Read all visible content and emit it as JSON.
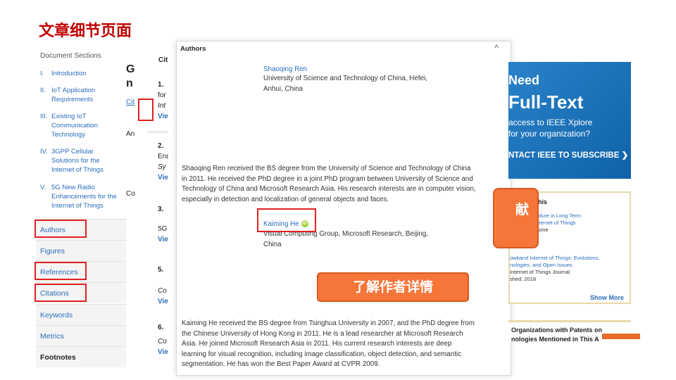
{
  "slide_title": "文章细节页面",
  "sections": {
    "heading": "Document Sections",
    "items": [
      {
        "num": "I.",
        "text": "Introduction"
      },
      {
        "num": "II.",
        "text": "IoT Application Requirements"
      },
      {
        "num": "III.",
        "text": "Existing IoT Communication Technology"
      },
      {
        "num": "IV.",
        "text": "3GPP Cellular Solutions for the Internet of Things"
      },
      {
        "num": "V.",
        "text": "5G New Radio Enhancements for the Internet of Things"
      }
    ],
    "nav": [
      "Authors",
      "Figures",
      "References",
      "Citations",
      "Keywords",
      "Metrics",
      "Footnotes"
    ]
  },
  "middle": {
    "frags": [
      "Cit",
      "1.",
      "for",
      "Int",
      "Vie",
      "2.",
      "End",
      "Sy",
      "Vie",
      "3.",
      "Co",
      "4.",
      "5G",
      "Vie",
      "5.",
      "Co",
      "Vie",
      "6.",
      "Co",
      "Vie",
      "G",
      "n",
      "Cit",
      "An"
    ]
  },
  "popup": {
    "title": "Authors",
    "close": "^",
    "author1": {
      "name": "Shaoqing Ren",
      "affil1": "University of Science and Technology of China, Hefei,",
      "affil2": "Anhui, China",
      "bio": [
        "Shaoqing Ren received the BS degree from the University of Science and Technology of China",
        "in 2011. He received the PhD degree in a joint PhD program between University of Science and",
        "Technology of China and Microsoft Research Asia. His research interests are in computer vision,",
        "especially in detection and localization of general objects and faces."
      ]
    },
    "author2": {
      "name": "Kaiming He",
      "orcid": "iD",
      "affil1": "Visual Computing Group, Microsoft Research, Beijing,",
      "affil2": "China",
      "bio": [
        "Kaiming He received the BS degree from Tsinghua University in 2007, and the PhD degree from",
        "the Chinese University of Hong Kong in 2011. He is a lead researcher at Microsoft Research",
        "Asia. He joined Microsoft Research Asia in 2011. His current research interests are deep",
        "learning for visual recognition, including image classification, object detection, and semantic",
        "segmentation. He has won the Best Paper Award at CVPR 2009."
      ]
    }
  },
  "callout": "了解作者详情",
  "callout2": "献",
  "ad": {
    "line1": "Need",
    "line2": "Full-Text",
    "line3a": "access to IEEE Xplore",
    "line3b": "for your organization?",
    "cta": "NTACT IEEE TO SUBSCRIBE ❯"
  },
  "panel2": {
    "title": "his",
    "lines": [
      "ccess Procedure in Long Term",
      "rks for the Internet of Things",
      "ations Magazine",
      "",
      "owband Internet of Things: Evolutions,",
      "nologies, and Open Issues",
      "Internet of Things Journal",
      "shed: 2018"
    ],
    "more": "Show More"
  },
  "panel3": {
    "line1": "Organizations with Patents on",
    "line2": "nologies Mentioned in This A"
  }
}
